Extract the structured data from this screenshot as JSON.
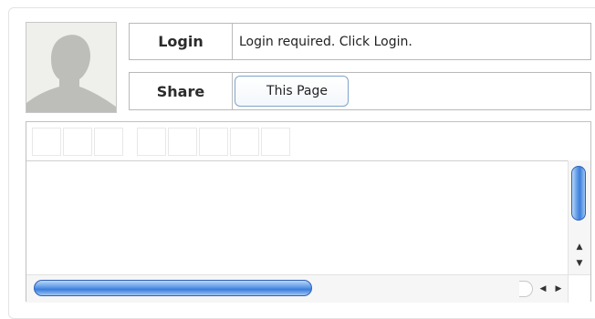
{
  "profile": {
    "avatar_icon": "default-user-silhouette-icon",
    "login_label": "Login",
    "login_status": "Login required. Click Login.",
    "share_label": "Share",
    "share_button_label": "This Page"
  },
  "editor": {
    "toolbar_left_group_count": 3,
    "toolbar_right_group_count": 5,
    "scroll_up_icon": "arrow-up-icon",
    "scroll_down_icon": "arrow-down-icon",
    "scroll_left_icon": "arrow-left-icon",
    "scroll_right_icon": "arrow-right-icon"
  },
  "colors": {
    "scroll_accent": "#3b7ddc",
    "border": "#b9b9b9"
  }
}
